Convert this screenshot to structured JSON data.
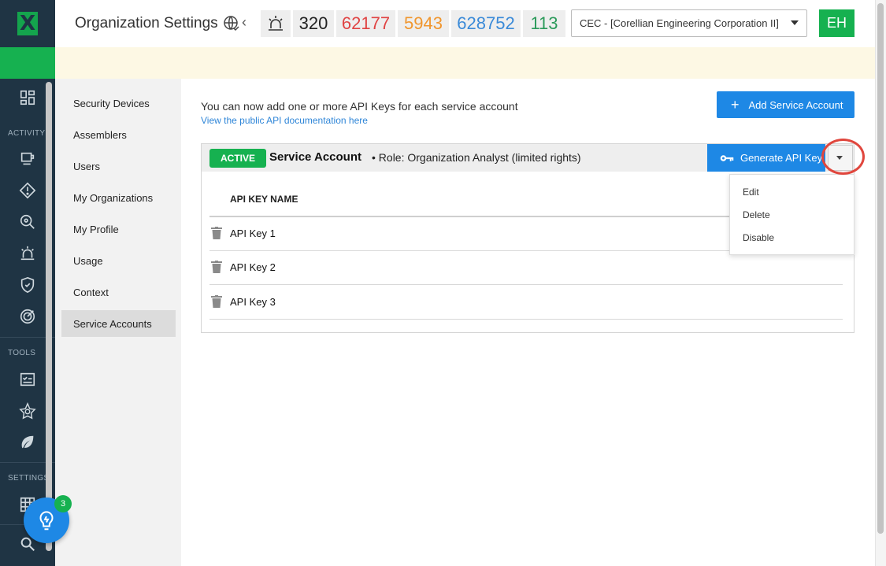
{
  "header": {
    "title": "Organization Settings",
    "counters": [
      "320",
      "62177",
      "5943",
      "628752",
      "113"
    ],
    "org_select": "CEC - [Corellian Engineering Corporation II]",
    "avatar": "EH"
  },
  "rail": {
    "logo": "X",
    "sections": [
      "ACTIVITY",
      "TOOLS",
      "SETTINGS"
    ]
  },
  "settings_nav": {
    "items": [
      "Security Devices",
      "Assemblers",
      "Users",
      "My Organizations",
      "My Profile",
      "Usage",
      "Context",
      "Service Accounts"
    ],
    "active": "Service Accounts"
  },
  "main": {
    "intro": "You can now add one or more API Keys for each service account",
    "doc_link": "View the public API documentation here",
    "add_button": "Add Service Account"
  },
  "service_account": {
    "status": "ACTIVE",
    "name": "Service Account",
    "role": "• Role: Organization Analyst (limited rights)",
    "generate_button": "Generate API Key",
    "column_header": "API KEY NAME",
    "keys": [
      "API Key 1",
      "API Key 2",
      "API Key 3"
    ]
  },
  "dropdown": {
    "items": [
      "Edit",
      "Delete",
      "Disable"
    ]
  },
  "help": {
    "badge_count": "3"
  },
  "colors": {
    "brand_green": "#16b150",
    "primary_blue": "#1e88e5",
    "rail_bg": "#1f3444",
    "highlight_red": "#e0463d"
  }
}
